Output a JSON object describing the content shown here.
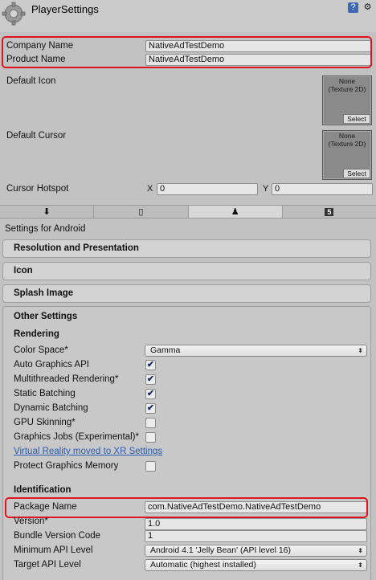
{
  "header": {
    "title": "PlayerSettings",
    "help_icon": "help-book-icon",
    "settings_icon": "gear-icon"
  },
  "identity": {
    "company_label": "Company Name",
    "company_value": "NativeAdTestDemo",
    "product_label": "Product Name",
    "product_value": "NativeAdTestDemo"
  },
  "icons": {
    "default_icon_label": "Default Icon",
    "default_cursor_label": "Default Cursor",
    "texture_none": "None",
    "texture_type": "(Texture 2D)",
    "select_label": "Select",
    "cursor_hotspot_label": "Cursor Hotspot",
    "x_label": "X",
    "x_value": "0",
    "y_label": "Y",
    "y_value": "0"
  },
  "tabs": [
    {
      "icon": "standalone-download-icon",
      "glyph": "⬇"
    },
    {
      "icon": "mobile-phone-icon",
      "glyph": "▯"
    },
    {
      "icon": "android-icon",
      "glyph": "♟"
    },
    {
      "icon": "html5-icon",
      "glyph": "5"
    }
  ],
  "settings_for": "Settings for Android",
  "sections": {
    "resolution": "Resolution and Presentation",
    "icon": "Icon",
    "splash": "Splash Image",
    "other": "Other Settings"
  },
  "rendering": {
    "heading": "Rendering",
    "color_space_label": "Color Space*",
    "color_space_value": "Gamma",
    "auto_graphics_label": "Auto Graphics API",
    "multithreaded_label": "Multithreaded Rendering*",
    "static_batching_label": "Static Batching",
    "dynamic_batching_label": "Dynamic Batching",
    "gpu_skinning_label": "GPU Skinning*",
    "graphics_jobs_label": "Graphics Jobs (Experimental)*",
    "vr_link": "Virtual Reality moved to XR Settings",
    "protect_memory_label": "Protect Graphics Memory",
    "checkmark": "✔"
  },
  "identification": {
    "heading": "Identification",
    "package_label": "Package Name",
    "package_value": "com.NativeAdTestDemo.NativeAdTestDemo",
    "version_label": "Version*",
    "version_value": "1.0",
    "bundle_label": "Bundle Version Code",
    "bundle_value": "1",
    "min_api_label": "Minimum API Level",
    "min_api_value": "Android 4.1 'Jelly Bean' (API level 16)",
    "target_api_label": "Target API Level",
    "target_api_value": "Automatic (highest installed)"
  },
  "colors": {
    "highlight": "#e0141e",
    "link": "#2a5db0"
  }
}
